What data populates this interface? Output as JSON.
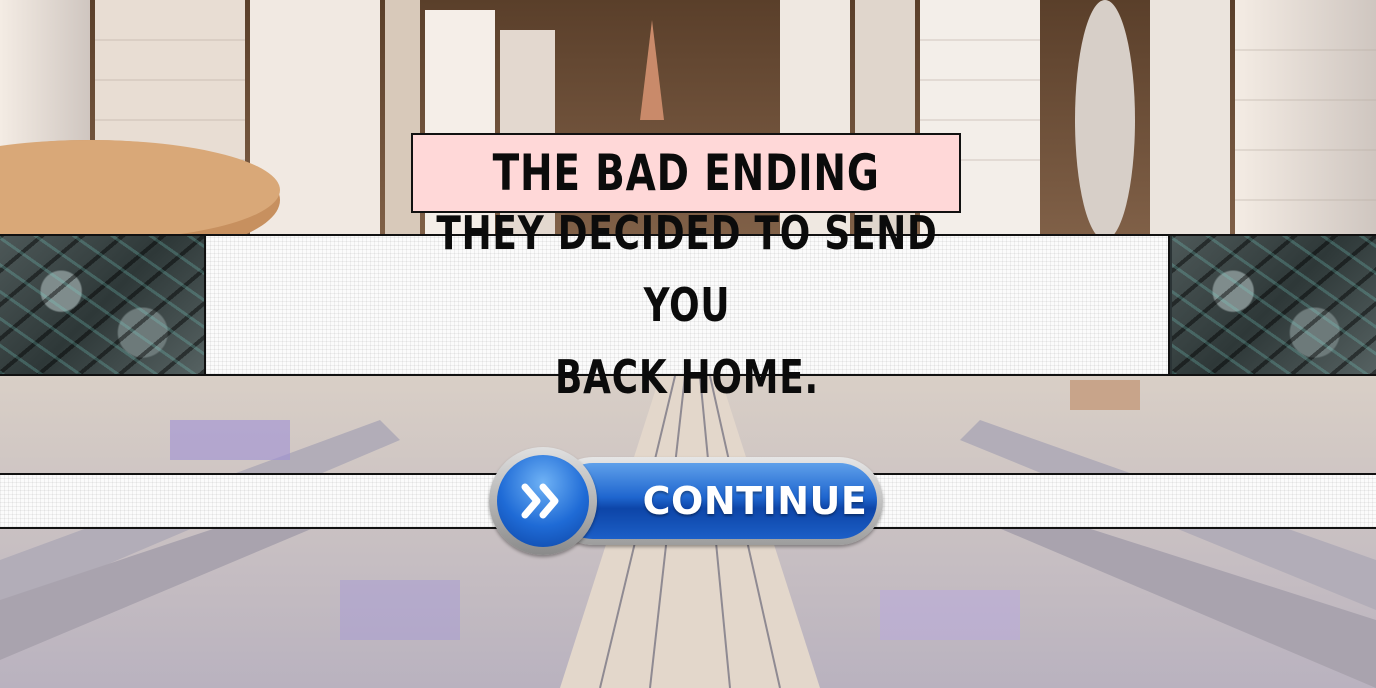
{
  "title": "THE BAD ENDING",
  "message": {
    "line1": "THEY DECIDED TO SEND YOU",
    "line2": "BACK HOME."
  },
  "continue_button": {
    "label": "CONTINUE",
    "icon": "double-chevron-right-icon"
  },
  "colors": {
    "title_background": "#ffd8d8",
    "button_blue": "#1f66cf",
    "text": "#0b0b0b"
  }
}
